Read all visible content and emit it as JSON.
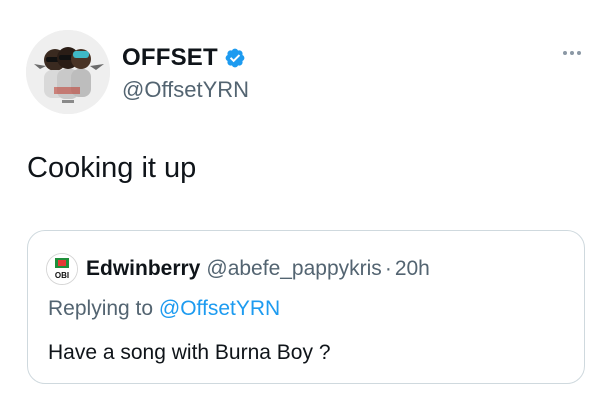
{
  "tweet": {
    "author": {
      "display_name": "OFFSET",
      "handle": "@OffsetYRN",
      "verified": true,
      "avatar_icon": "album-cover-avatar"
    },
    "text": "Cooking it up",
    "more_icon": "more-horizontal-icon"
  },
  "quoted_tweet": {
    "author": {
      "display_name": "Edwinberry",
      "handle": "@abefe_pappykris",
      "avatar_icon": "obi-logo-avatar",
      "avatar_text": "OBI"
    },
    "separator": "·",
    "time": "20h",
    "replying_prefix": "Replying to",
    "replying_to": "@OffsetYRN",
    "text": "Have a song with Burna Boy ?"
  },
  "colors": {
    "text_primary": "#0f1419",
    "text_secondary": "#536471",
    "link": "#1d9bf0",
    "verified": "#1d9bf0",
    "border": "#cfd9de"
  }
}
